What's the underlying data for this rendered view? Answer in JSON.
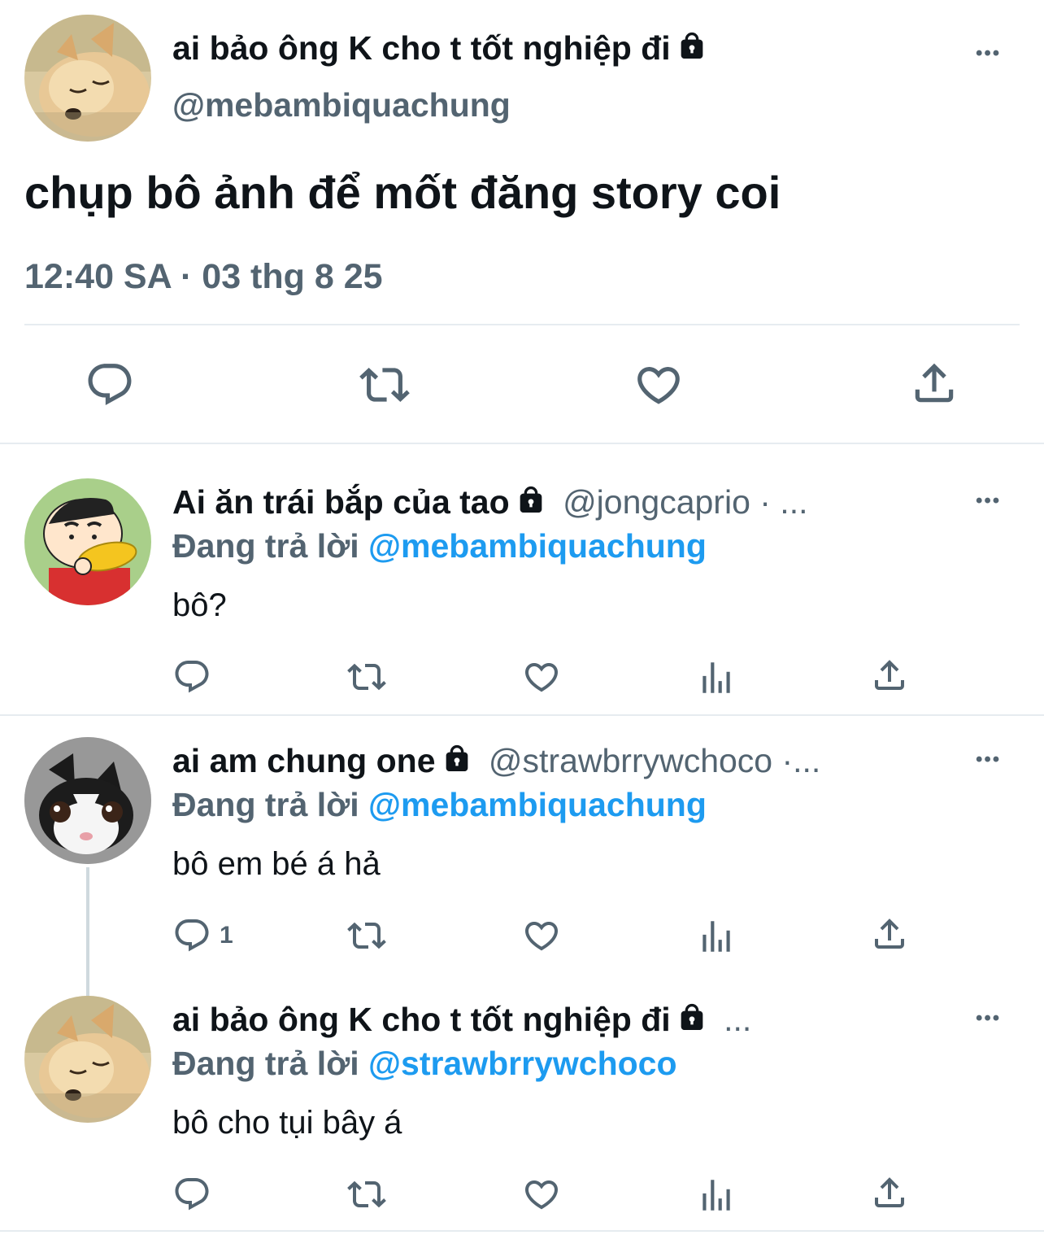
{
  "main_tweet": {
    "display_name": "ai bảo ông K cho t tốt nghiệp đi",
    "handle": "@mebambiquachung",
    "text": "chụp bô ảnh để mốt đăng story coi",
    "timestamp": "12:40 SA · 03 thg 8 25",
    "more": "•••",
    "avatar": "sleeping-dog-avatar",
    "actions": [
      "reply-icon",
      "retweet-icon",
      "like-icon",
      "share-icon"
    ]
  },
  "replies": [
    {
      "display_name": "Ai ăn trái bắp của tao",
      "handle": "@jongcaprio · ...",
      "replying_prefix": "Đang trả lời",
      "replying_to": "@mebambiquachung",
      "text": "bô?",
      "more": "•••",
      "avatar": "cartoon-boy-corn-avatar",
      "reply_count": ""
    },
    {
      "display_name": "ai am chung one",
      "handle": "@strawbrrywchoco ·...",
      "replying_prefix": "Đang trả lời",
      "replying_to": "@mebambiquachung",
      "text": "bô em bé á hả",
      "more": "•••",
      "avatar": "kitten-avatar",
      "reply_count": "1"
    },
    {
      "display_name": "ai bảo ông K cho t tốt nghiệp đi",
      "handle": "...",
      "replying_prefix": "Đang trả lời",
      "replying_to": "@strawbrrywchoco",
      "text": "bô cho tụi bây á",
      "more": "•••",
      "avatar": "sleeping-dog-avatar",
      "reply_count": ""
    }
  ],
  "colors": {
    "text": "#0f1419",
    "muted": "#536471",
    "link": "#1d9bf0",
    "divider": "#e6ecf0"
  }
}
